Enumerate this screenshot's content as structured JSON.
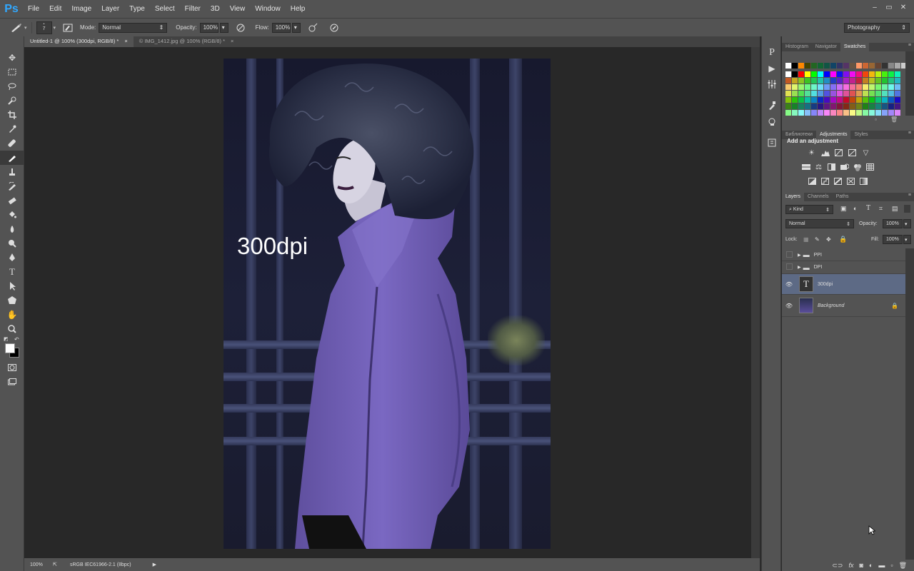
{
  "app": {
    "logo": "Ps"
  },
  "menu": [
    "File",
    "Edit",
    "Image",
    "Layer",
    "Type",
    "Select",
    "Filter",
    "3D",
    "View",
    "Window",
    "Help"
  ],
  "window_controls": [
    "–",
    "▭",
    "✕"
  ],
  "options_bar": {
    "brush_size": "7",
    "mode_label": "Mode:",
    "mode_value": "Normal",
    "opacity_label": "Opacity:",
    "opacity_value": "100%",
    "flow_label": "Flow:",
    "flow_value": "100%",
    "workspace": "Photography"
  },
  "doc_tabs": [
    {
      "title": "Untitled-1 @ 100% (300dpi, RGB/8) *",
      "active": true
    },
    {
      "title": "© IMG_1412.jpg @ 100% (RGB/8) *",
      "active": false
    }
  ],
  "canvas": {
    "text_layer": "300dpi"
  },
  "status_bar": {
    "zoom": "100%",
    "profile": "sRGB IEC61966-2.1 (8bpc)"
  },
  "panels": {
    "top_tabs": [
      "Histogram",
      "Navigator",
      "Swatches"
    ],
    "top_active": "Swatches",
    "mid_tabs": [
      "Библиотеки",
      "Adjustments",
      "Styles"
    ],
    "mid_active": "Adjustments",
    "adjustments_title": "Add an adjustment",
    "layers_tabs": [
      "Layers",
      "Channels",
      "Paths"
    ],
    "layers_active": "Layers",
    "filter_kind": "Kind",
    "blend_mode": "Normal",
    "opacity_label": "Opacity:",
    "opacity_value": "100%",
    "lock_label": "Lock:",
    "fill_label": "Fill:",
    "fill_value": "100%"
  },
  "layers": [
    {
      "name": "PPI",
      "type": "group",
      "visible": false
    },
    {
      "name": "DPI",
      "type": "group",
      "visible": false
    },
    {
      "name": "300dpi",
      "type": "text",
      "visible": true,
      "selected": true
    },
    {
      "name": "Background",
      "type": "image",
      "visible": true,
      "locked": true
    }
  ],
  "swatch_colors": [
    "#ffffff",
    "#000000",
    "#ff0000",
    "#ffff00",
    "#00ff00",
    "#00ffff",
    "#0000ff",
    "#ff00ff"
  ],
  "colors": {
    "accent": "#31a8ff",
    "ui_bg": "#535353",
    "canvas_bg": "#282828",
    "selected_layer": "#5d6a85"
  }
}
